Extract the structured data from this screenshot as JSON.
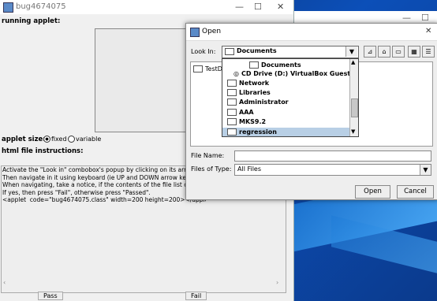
{
  "main_window": {
    "title": "bug4674075",
    "minimize": "—",
    "maximize": "☐",
    "close": "✕",
    "running_applet_label": "running applet:",
    "applet_size_label": "applet size:",
    "fixed_label": "fixed",
    "variable_label": "variable",
    "html_instructions_label": "html file instructions:",
    "instructions_text": "Activate the \"Look in\" combobox's popup by clicking on its arrow but\nThen navigate in it using keyboard (ie UP and DOWN arrow keys).\nWhen navigating, take a notice, if the contents of the file list change:\nIf yes, then press \"Fail\", otherwise press \"Passed\".\n<applet  code=\"bug4674075.class\" width=200 height=200></applet>",
    "pass_button": "Pass",
    "fail_button": "Fail"
  },
  "bg_window": {
    "minimize": "—",
    "maximize": "☐"
  },
  "dialog": {
    "title": "Open",
    "close": "✕",
    "look_in_label": "Look In:",
    "look_in_value": "Documents",
    "popup_items": [
      {
        "label": "Documents",
        "selected": false
      },
      {
        "label": "CD Drive (D:) VirtualBox Guest Addition",
        "selected": false
      },
      {
        "label": "Network",
        "selected": false
      },
      {
        "label": "Libraries",
        "selected": false
      },
      {
        "label": "Administrator",
        "selected": false
      },
      {
        "label": "AAA",
        "selected": false
      },
      {
        "label": "MKS9.2",
        "selected": false
      },
      {
        "label": "regression",
        "selected": true
      }
    ],
    "file_list_item": "TestD",
    "file_name_label": "File Name:",
    "file_name_value": "",
    "files_of_type_label": "Files of Type:",
    "files_of_type_value": "All Files",
    "open_button": "Open",
    "cancel_button": "Cancel"
  }
}
